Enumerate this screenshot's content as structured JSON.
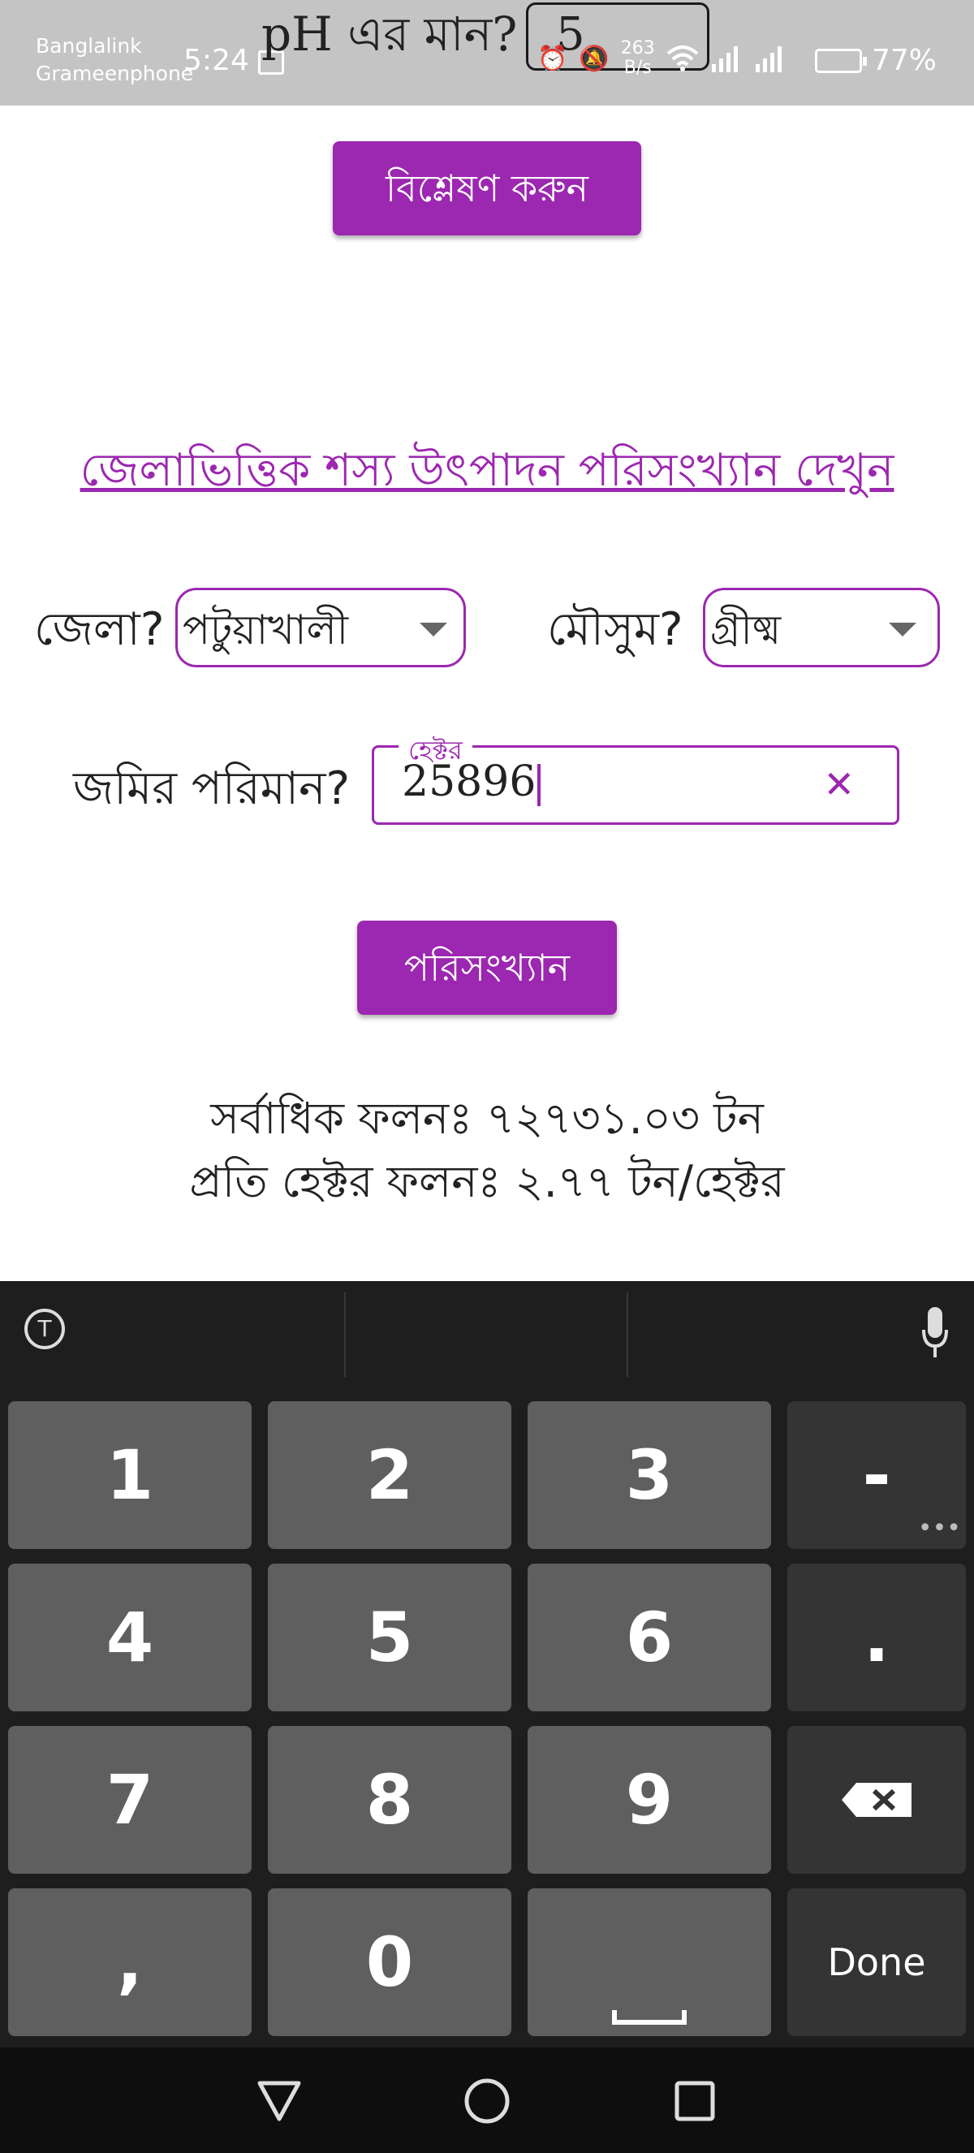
{
  "status_bar": {
    "carrier_line1": "Banglalink",
    "carrier_line2": "Grameenphone",
    "time": "5:24",
    "net_speed_value": "263",
    "net_speed_unit": "B/s",
    "battery": "77%"
  },
  "ph_row": {
    "label": "pH এর মান?",
    "value": "5"
  },
  "analyze_button": "বিশ্লেষণ করুন",
  "district_link": "জেলাভিত্তিক শস্য উৎপাদন পরিসংখ্যান দেখুন",
  "district": {
    "label": "জেলা?",
    "value": "পটুয়াখালী"
  },
  "season": {
    "label": "মৌসুম?",
    "value": "গ্রীষ্ম"
  },
  "land": {
    "label": "জমির পরিমান?",
    "floating_label": "হেক্টর",
    "value": "25896"
  },
  "stats_button": "পরিসংখ্যান",
  "results": {
    "max_yield": "সর্বাধিক ফলনঃ ৭২৭৩১.০৩ টন",
    "per_hectare": "প্রতি হেক্টর ফলনঃ ২.৭৭ টন/হেক্টর"
  },
  "keyboard": {
    "translate_icon_letter": "T",
    "rows": [
      [
        "1",
        "2",
        "3",
        "-"
      ],
      [
        "4",
        "5",
        "6",
        "."
      ],
      [
        "7",
        "8",
        "9",
        ""
      ],
      [
        ",",
        "0",
        "",
        "Done"
      ]
    ]
  },
  "colors": {
    "accent": "#9c27b0",
    "status_bar": "#c4c4c4",
    "keyboard_bg": "#1e1e1e",
    "key_bg": "#5f5f5f"
  }
}
